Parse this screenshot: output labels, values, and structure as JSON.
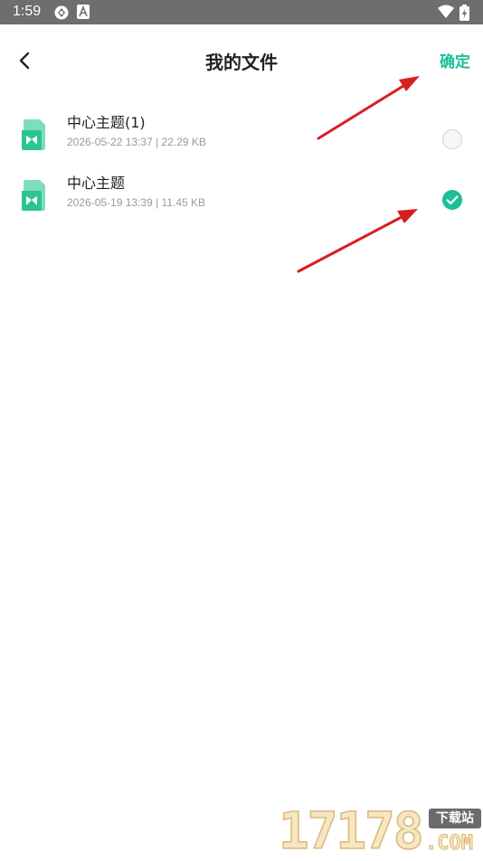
{
  "status_bar": {
    "time": "1:59",
    "icons": [
      "sync-icon",
      "keyboard-a-icon",
      "wifi-icon",
      "battery-charging-icon"
    ]
  },
  "header": {
    "back_icon": "chevron-left-icon",
    "title": "我的文件",
    "confirm_label": "确定"
  },
  "files": [
    {
      "name": "中心主题(1)",
      "meta": "2026-05-22 13:37 | 22.29 KB",
      "selected": false,
      "icon": "xmind-file-icon"
    },
    {
      "name": "中心主题",
      "meta": "2026-05-19 13:39 | 11.45 KB",
      "selected": true,
      "icon": "xmind-file-icon"
    }
  ],
  "annotations": [
    "red-arrow-to-confirm",
    "red-arrow-to-selected-radio"
  ],
  "watermark": {
    "logo_text": "17178",
    "badge_text": "下载站",
    "suffix_text": ".COM"
  },
  "colors": {
    "accent": "#1cbf97",
    "status_bar": "#6e6e6e",
    "arrow": "#d81f1f",
    "radio_off": "#d8d8d8"
  }
}
